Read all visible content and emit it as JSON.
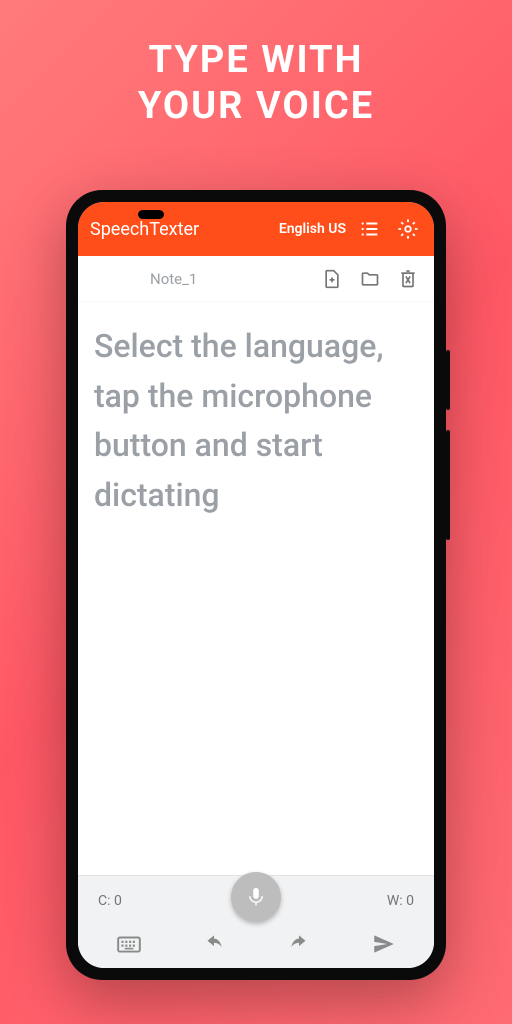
{
  "promo": {
    "line1": "TYPE WITH",
    "line2": "YOUR VOICE"
  },
  "app_bar": {
    "title": "SpeechTexter",
    "language": "English US"
  },
  "doc_bar": {
    "note_title": "Note_1"
  },
  "content": {
    "placeholder_text": "Select the language, tap the microphone button and start dictating"
  },
  "footer": {
    "char_count_label": "C: 0",
    "word_count_label": "W: 0"
  }
}
